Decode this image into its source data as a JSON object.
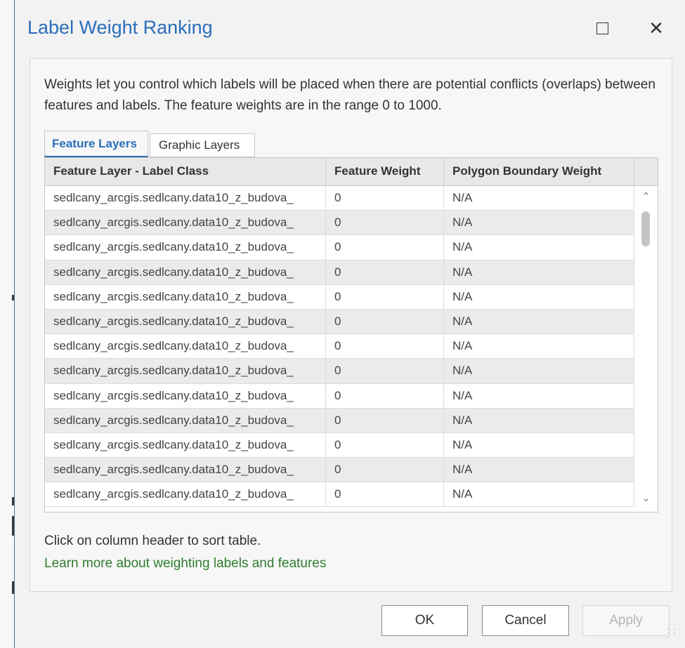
{
  "dialog": {
    "title": "Label Weight Ranking",
    "maximize_icon": "maximize-icon",
    "close_icon": "close-icon",
    "close_glyph": "✕"
  },
  "description": "Weights let you control which labels will be placed when there are potential conflicts (overlaps) between features and labels. The feature weights are in the range 0 to 1000.",
  "tabs": [
    {
      "label": "Feature Layers",
      "active": true
    },
    {
      "label": "Graphic Layers",
      "active": false
    }
  ],
  "table": {
    "columns": [
      "Feature Layer - Label Class",
      "Feature Weight",
      "Polygon Boundary Weight"
    ],
    "rows": [
      [
        "sedlcany_arcgis.sedlcany.data10_z_budova_",
        "0",
        "N/A"
      ],
      [
        "sedlcany_arcgis.sedlcany.data10_z_budova_",
        "0",
        "N/A"
      ],
      [
        "sedlcany_arcgis.sedlcany.data10_z_budova_",
        "0",
        "N/A"
      ],
      [
        "sedlcany_arcgis.sedlcany.data10_z_budova_",
        "0",
        "N/A"
      ],
      [
        "sedlcany_arcgis.sedlcany.data10_z_budova_",
        "0",
        "N/A"
      ],
      [
        "sedlcany_arcgis.sedlcany.data10_z_budova_",
        "0",
        "N/A"
      ],
      [
        "sedlcany_arcgis.sedlcany.data10_z_budova_",
        "0",
        "N/A"
      ],
      [
        "sedlcany_arcgis.sedlcany.data10_z_budova_",
        "0",
        "N/A"
      ],
      [
        "sedlcany_arcgis.sedlcany.data10_z_budova_",
        "0",
        "N/A"
      ],
      [
        "sedlcany_arcgis.sedlcany.data10_z_budova_",
        "0",
        "N/A"
      ],
      [
        "sedlcany_arcgis.sedlcany.data10_z_budova_",
        "0",
        "N/A"
      ],
      [
        "sedlcany_arcgis.sedlcany.data10_z_budova_",
        "0",
        "N/A"
      ],
      [
        "sedlcany_arcgis.sedlcany.data10_z_budova_",
        "0",
        "N/A"
      ]
    ],
    "scroll_up_glyph": "⌃",
    "scroll_down_glyph": "⌄"
  },
  "hint": "Click on column header to sort table.",
  "learn_more": "Learn more about weighting labels and features",
  "buttons": {
    "ok": "OK",
    "cancel": "Cancel",
    "apply": "Apply"
  },
  "colors": {
    "accent": "#2a6ebb",
    "link": "#2f7d2f",
    "disabled": "#b5b5b5"
  }
}
